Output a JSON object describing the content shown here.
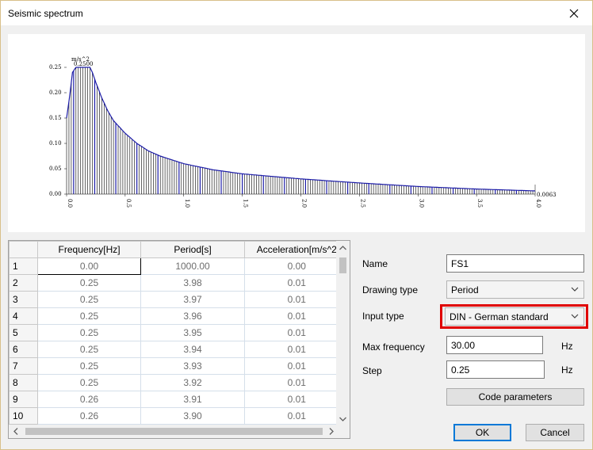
{
  "window": {
    "title": "Seismic spectrum"
  },
  "chart_data": {
    "type": "bar",
    "xlabel": "",
    "ylabel": "",
    "y_unit_label": "m/s^2",
    "xlim": [
      0,
      4.0
    ],
    "ylim": [
      0,
      0.25
    ],
    "x_ticks": [
      "0.0",
      "0.5",
      "1.0",
      "1.5",
      "2.0",
      "2.5",
      "3.0",
      "3.5",
      "4.0"
    ],
    "y_ticks": [
      "0.00",
      "0.05",
      "0.10",
      "0.15",
      "0.20",
      "0.25"
    ],
    "annotations": {
      "peak": "0.2500",
      "end": "0.0063"
    },
    "bar_color": "#000000",
    "highlight_color": "#1c1ca8",
    "outline_color": "#1c1ca8",
    "x": [
      0.0,
      0.03,
      0.05,
      0.08,
      0.1,
      0.15,
      0.2,
      0.22,
      0.25,
      0.3,
      0.35,
      0.4,
      0.5,
      0.6,
      0.7,
      0.8,
      1.0,
      1.25,
      1.5,
      2.0,
      2.5,
      3.0,
      3.5,
      4.0
    ],
    "values": [
      0.15,
      0.2,
      0.24,
      0.25,
      0.25,
      0.25,
      0.25,
      0.24,
      0.22,
      0.19,
      0.165,
      0.145,
      0.12,
      0.1,
      0.085,
      0.075,
      0.06,
      0.048,
      0.04,
      0.03,
      0.022,
      0.015,
      0.01,
      0.0063
    ]
  },
  "table": {
    "headers": [
      "",
      "Frequency[Hz]",
      "Period[s]",
      "Acceleration[m/s^2"
    ],
    "rows": [
      [
        "1",
        "0.00",
        "1000.00",
        "0.00"
      ],
      [
        "2",
        "0.25",
        "3.98",
        "0.01"
      ],
      [
        "3",
        "0.25",
        "3.97",
        "0.01"
      ],
      [
        "4",
        "0.25",
        "3.96",
        "0.01"
      ],
      [
        "5",
        "0.25",
        "3.95",
        "0.01"
      ],
      [
        "6",
        "0.25",
        "3.94",
        "0.01"
      ],
      [
        "7",
        "0.25",
        "3.93",
        "0.01"
      ],
      [
        "8",
        "0.25",
        "3.92",
        "0.01"
      ],
      [
        "9",
        "0.26",
        "3.91",
        "0.01"
      ],
      [
        "10",
        "0.26",
        "3.90",
        "0.01"
      ]
    ]
  },
  "form": {
    "name_label": "Name",
    "name_value": "FS1",
    "drawing_type_label": "Drawing type",
    "drawing_type_value": "Period",
    "input_type_label": "Input type",
    "input_type_value": "DIN - German standard",
    "max_freq_label": "Max frequency",
    "max_freq_value": "30.00",
    "max_freq_unit": "Hz",
    "step_label": "Step",
    "step_value": "0.25",
    "step_unit": "Hz",
    "code_params_label": "Code parameters"
  },
  "buttons": {
    "ok": "OK",
    "cancel": "Cancel"
  },
  "colors": {
    "highlight_frame": "#e00000",
    "default_button_border": "#0078d7"
  }
}
